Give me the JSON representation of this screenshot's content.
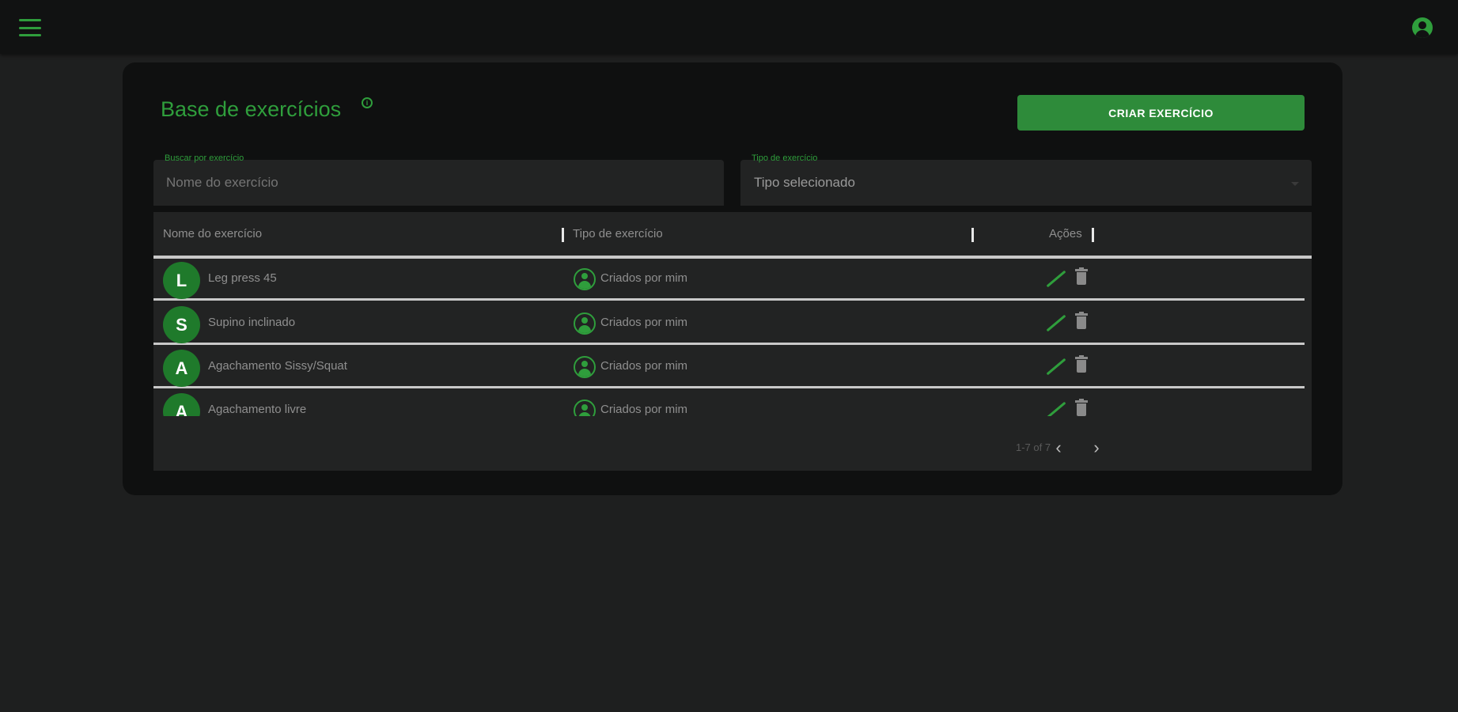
{
  "topbar": {
    "menu_icon": "menu-icon",
    "account_icon": "account-circle-icon",
    "accent_color": "#2f9e3c"
  },
  "page": {
    "title": "Base de exercícios",
    "create_button": "CRIAR EXERCÍCIO"
  },
  "filters": {
    "name_label": "Buscar por exercício",
    "name_placeholder": "Nome do exercício",
    "type_label": "Tipo de exercício",
    "type_value": "Tipo selecionado"
  },
  "table": {
    "columns": [
      "Nome do exercício",
      "Tipo de exercício",
      "Ações"
    ],
    "rows": [
      {
        "initial": "L",
        "name": "Leg press 45",
        "type": "Criados por mim"
      },
      {
        "initial": "S",
        "name": "Supino inclinado",
        "type": "Criados por mim"
      },
      {
        "initial": "A",
        "name": "Agachamento Sissy/Squat",
        "type": "Criados por mim"
      },
      {
        "initial": "A",
        "name": "Agachamento livre",
        "type": "Criados por mim"
      }
    ],
    "pagination": {
      "info": "1-7 of 7"
    }
  }
}
